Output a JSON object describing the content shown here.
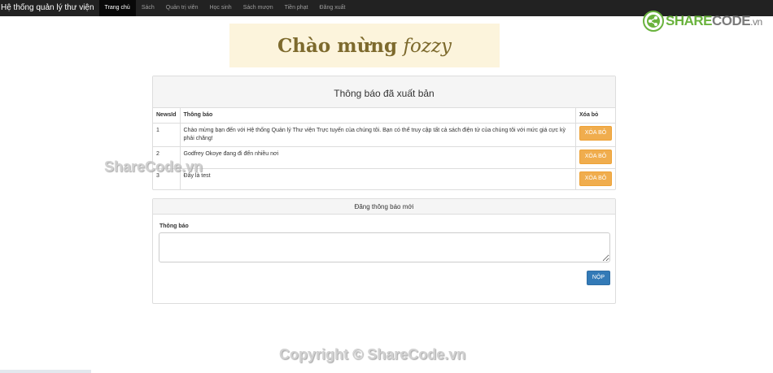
{
  "navbar": {
    "brand": "Hệ thống quản lý thư viện",
    "items": [
      {
        "label": "Trang chủ",
        "active": true
      },
      {
        "label": "Sách",
        "active": false
      },
      {
        "label": "Quản trị viên",
        "active": false
      },
      {
        "label": "Học sinh",
        "active": false
      },
      {
        "label": "Sách mượn",
        "active": false
      },
      {
        "label": "Tiền phạt",
        "active": false
      },
      {
        "label": "Đăng xuất",
        "active": false
      }
    ]
  },
  "logo": {
    "share": "SHARE",
    "code": "CODE",
    "vn": ".vn"
  },
  "welcome": {
    "bold": "Chào mừng",
    "italic": "fozzy"
  },
  "news_panel": {
    "title": "Thông báo đã xuất bản",
    "columns": [
      "NewsId",
      "Thông báo",
      "Xóa bỏ"
    ],
    "rows": [
      {
        "id": "1",
        "text": "Chào mừng bạn đến với Hệ thống Quản lý Thư viện Trực tuyến của chúng tôi. Bạn có thể truy cập tất cả sách điện tử của chúng tôi với mức giá cực kỳ phải chăng!",
        "delete_label": "XÓA BỎ"
      },
      {
        "id": "2",
        "text": "Godfrey Okoye đang đi đến nhiều nơi",
        "delete_label": "XÓA BỎ"
      },
      {
        "id": "3",
        "text": "Đây là test",
        "delete_label": "XÓA BỎ"
      }
    ]
  },
  "post_panel": {
    "title": "Đăng thông báo mới",
    "field_label": "Thông báo",
    "field_value": "",
    "submit_label": "NỘP"
  },
  "watermarks": {
    "left": "ShareCode.vn",
    "bottom": "Copyright © ShareCode.vn"
  },
  "colors": {
    "navbar": "#222222",
    "warning": "#f0ad4e",
    "primary": "#337ab7",
    "welcome_bg": "#fcf4dc",
    "logo_green": "#6ab33e"
  }
}
